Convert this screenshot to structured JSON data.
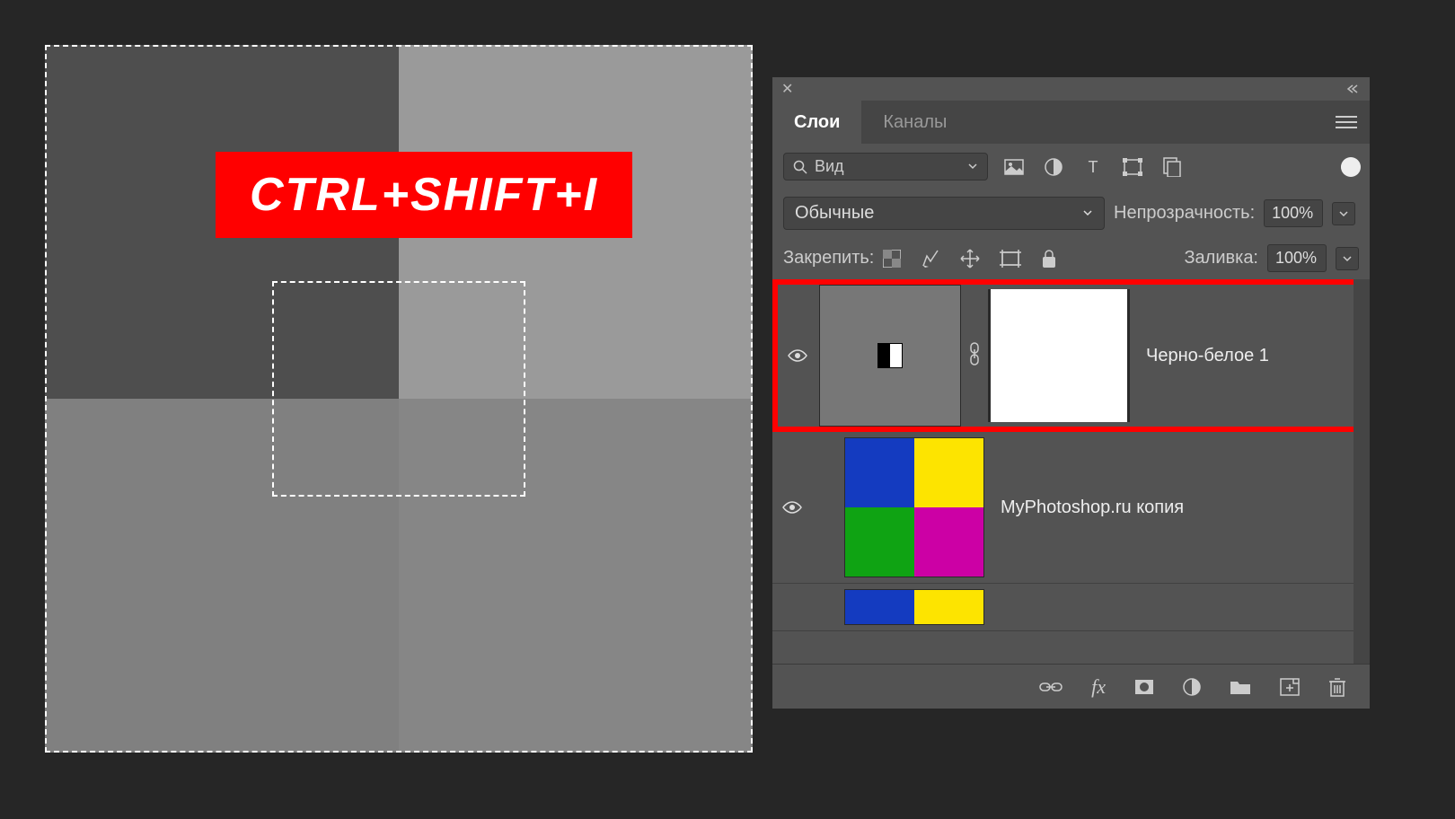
{
  "overlay_text": "CTRL+SHIFT+I",
  "panel": {
    "tabs": {
      "layers": "Слои",
      "channels": "Каналы"
    },
    "filter": {
      "label": "Вид"
    },
    "blend": {
      "mode": "Обычные",
      "opacity_label": "Непрозрачность:",
      "opacity_value": "100%"
    },
    "lock": {
      "label": "Закрепить:",
      "fill_label": "Заливка:",
      "fill_value": "100%"
    },
    "layers": [
      {
        "name": "Черно-белое 1"
      },
      {
        "name": "MyPhotoshop.ru копия"
      }
    ]
  }
}
